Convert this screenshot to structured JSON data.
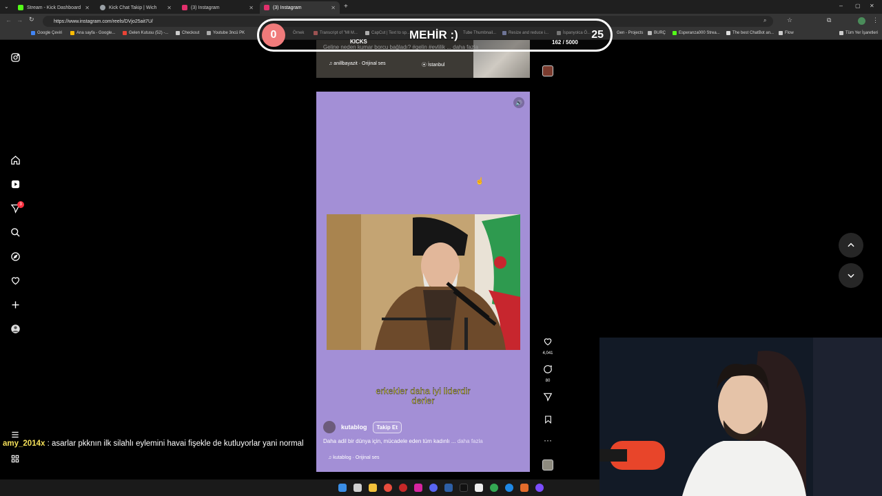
{
  "browser": {
    "tabs": [
      {
        "title": "Stream - Kick Dashboard",
        "color": "#53fc18"
      },
      {
        "title": "Kick Chat Takip | Wich",
        "color": "#9aa0a6"
      },
      {
        "title": "(3) Instagram",
        "color": "#e1306c"
      },
      {
        "title": "(3) Instagram",
        "color": "#e1306c",
        "active": true
      }
    ],
    "url": "https://www.instagram.com/reels/DVjo25ait7U/",
    "bookmarks": [
      "Google Çeviri",
      "Ana sayfa - Google...",
      "Gelen Kutusu (52) -...",
      "Checkout",
      "Youtube 3ncü PK",
      "Örnek",
      "Transcript of \"Ml M...",
      "CapCut | Text to sp...",
      "Tube Thumbnail...",
      "Resize and reduce i...",
      "İspanyolca Ö...",
      "Gen - Projects",
      "BURÇ",
      "Esperanza000 Strea...",
      "The best ChatBot an...",
      "Flow",
      "Tüm Yer İşaretleri"
    ]
  },
  "kicks_overlay": {
    "left_score": "0",
    "name": "MEHİR :)",
    "right_score": "25",
    "label": "KICKS",
    "progress_text": "162 / 5000"
  },
  "instagram": {
    "nav": {
      "notifications_badge": "3"
    },
    "prev_reel": {
      "caption": "Geline neden kumar borcu bağladı? #gelin #evlilik ... daha fazla",
      "music": "anillbayazit · Orijinal ses",
      "location": "İstanbul"
    },
    "reel": {
      "subtitle_line1": "erkekler daha iyi liderdir",
      "subtitle_line2": "derler",
      "author": "kutablog",
      "follow_label": "Takip Et",
      "caption": "Daha adil bir dünya için, mücadele eden tüm kadınlı ...",
      "caption_more": "daha fazla",
      "music": "kutablog · Orijinal ses"
    },
    "actions": {
      "likes": "4,041",
      "comments": "80"
    }
  },
  "chat": {
    "user": "amy_2014x",
    "message": " : asarlar pkknın ilk silahlı eylemini havai fişekle de kutluyorlar yani normal"
  },
  "colors": {
    "reel_bg": "#a38fd6",
    "subtitle": "#f2e64a",
    "chrome": "#353535"
  }
}
